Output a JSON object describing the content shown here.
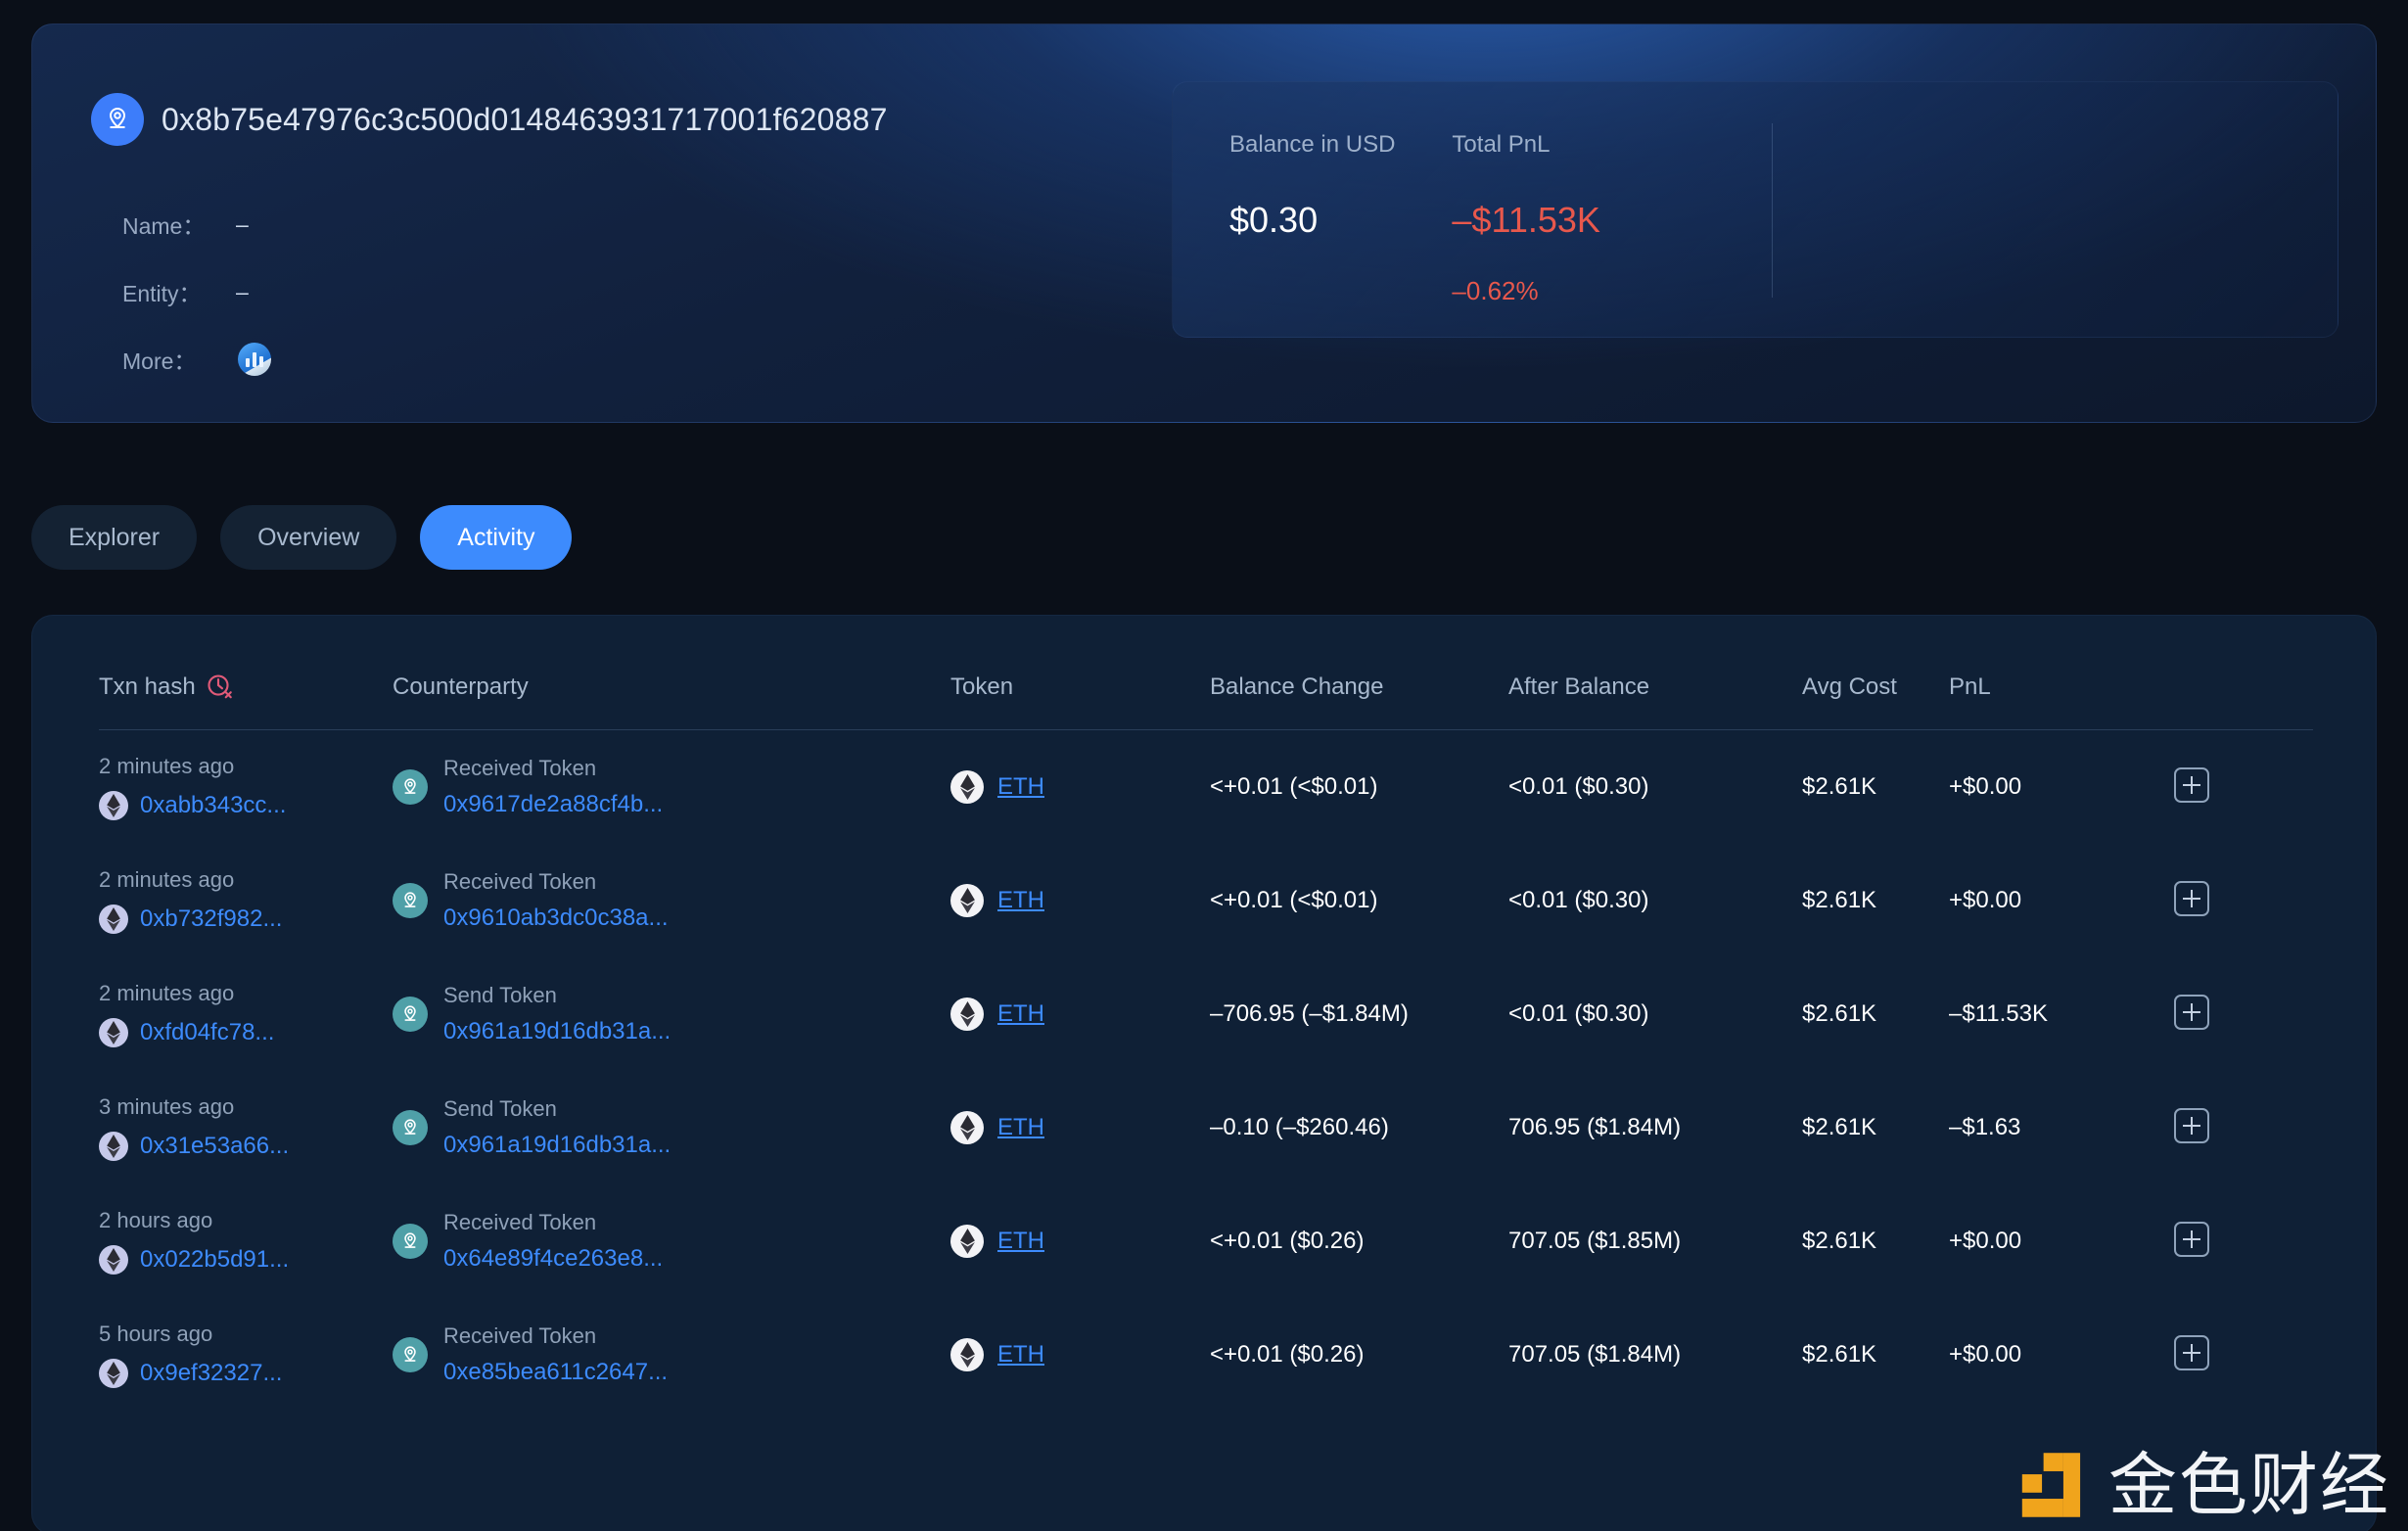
{
  "profile": {
    "address": "0x8b75e47976c3c500d0148463931717001f620887",
    "avatar_icon": "location-pin-icon",
    "meta": [
      {
        "label": "Name：",
        "value": "–"
      },
      {
        "label": "Entity：",
        "value": "–"
      },
      {
        "label": "More：",
        "value": "",
        "icon": "analytics-badge-icon"
      }
    ]
  },
  "stats": {
    "balance_label": "Balance in USD",
    "balance_value": "$0.30",
    "pnl_label": "Total PnL",
    "pnl_value": "–$11.53K",
    "pnl_percent": "–0.62%"
  },
  "tabs": [
    {
      "label": "Explorer",
      "active": false
    },
    {
      "label": "Overview",
      "active": false
    },
    {
      "label": "Activity",
      "active": true
    }
  ],
  "table": {
    "headers": {
      "txn_hash": "Txn hash",
      "counterparty": "Counterparty",
      "token": "Token",
      "balance_change": "Balance Change",
      "after_balance": "After Balance",
      "avg_cost": "Avg Cost",
      "pnl": "PnL",
      "action": ""
    },
    "header_icon": "clock-x-icon",
    "rows": [
      {
        "ago": "2 minutes ago",
        "hash": "0xabb343cc...",
        "cp_type": "Received Token",
        "cp_addr": "0x9617de2a88cf4b...",
        "token": "ETH",
        "balance_change": "<+0.01 (<$0.01)",
        "balance_change_sign": "pos",
        "after_balance": "<0.01 ($0.30)",
        "avg_cost": "$2.61K",
        "pnl": "+$0.00",
        "pnl_sign": "neutral",
        "action_icon": "plus-box-icon"
      },
      {
        "ago": "2 minutes ago",
        "hash": "0xb732f982...",
        "cp_type": "Received Token",
        "cp_addr": "0x9610ab3dc0c38a...",
        "token": "ETH",
        "balance_change": "<+0.01 (<$0.01)",
        "balance_change_sign": "pos",
        "after_balance": "<0.01 ($0.30)",
        "avg_cost": "$2.61K",
        "pnl": "+$0.00",
        "pnl_sign": "neutral",
        "action_icon": "plus-box-icon"
      },
      {
        "ago": "2 minutes ago",
        "hash": "0xfd04fc78...",
        "cp_type": "Send Token",
        "cp_addr": "0x961a19d16db31a...",
        "token": "ETH",
        "balance_change": "–706.95 (–$1.84M)",
        "balance_change_sign": "neg",
        "after_balance": "<0.01 ($0.30)",
        "avg_cost": "$2.61K",
        "pnl": "–$11.53K",
        "pnl_sign": "neg",
        "action_icon": "plus-box-icon"
      },
      {
        "ago": "3 minutes ago",
        "hash": "0x31e53a66...",
        "cp_type": "Send Token",
        "cp_addr": "0x961a19d16db31a...",
        "token": "ETH",
        "balance_change": "–0.10 (–$260.46)",
        "balance_change_sign": "neg",
        "after_balance": "706.95 ($1.84M)",
        "avg_cost": "$2.61K",
        "pnl": "–$1.63",
        "pnl_sign": "neg",
        "action_icon": "plus-box-icon"
      },
      {
        "ago": "2 hours ago",
        "hash": "0x022b5d91...",
        "cp_type": "Received Token",
        "cp_addr": "0x64e89f4ce263e8...",
        "token": "ETH",
        "balance_change": "<+0.01 ($0.26)",
        "balance_change_sign": "pos",
        "after_balance": "707.05 ($1.85M)",
        "avg_cost": "$2.61K",
        "pnl": "+$0.00",
        "pnl_sign": "neutral",
        "action_icon": "plus-box-icon"
      },
      {
        "ago": "5 hours ago",
        "hash": "0x9ef32327...",
        "cp_type": "Received Token",
        "cp_addr": "0xe85bea611c2647...",
        "token": "ETH",
        "balance_change": "<+0.01 ($0.26)",
        "balance_change_sign": "pos",
        "after_balance": "707.05 ($1.84M)",
        "avg_cost": "$2.61K",
        "pnl": "+$0.00",
        "pnl_sign": "neutral",
        "action_icon": "plus-box-icon"
      }
    ]
  },
  "watermark": {
    "text": "金色财经",
    "mark_color": "#f0a41c"
  },
  "colors": {
    "accent_blue": "#3d8bfd",
    "positive_green": "#63c98b",
    "negative_red": "#e8584c",
    "page_bg": "#0a0f18",
    "card_bg": "#0f2036"
  }
}
